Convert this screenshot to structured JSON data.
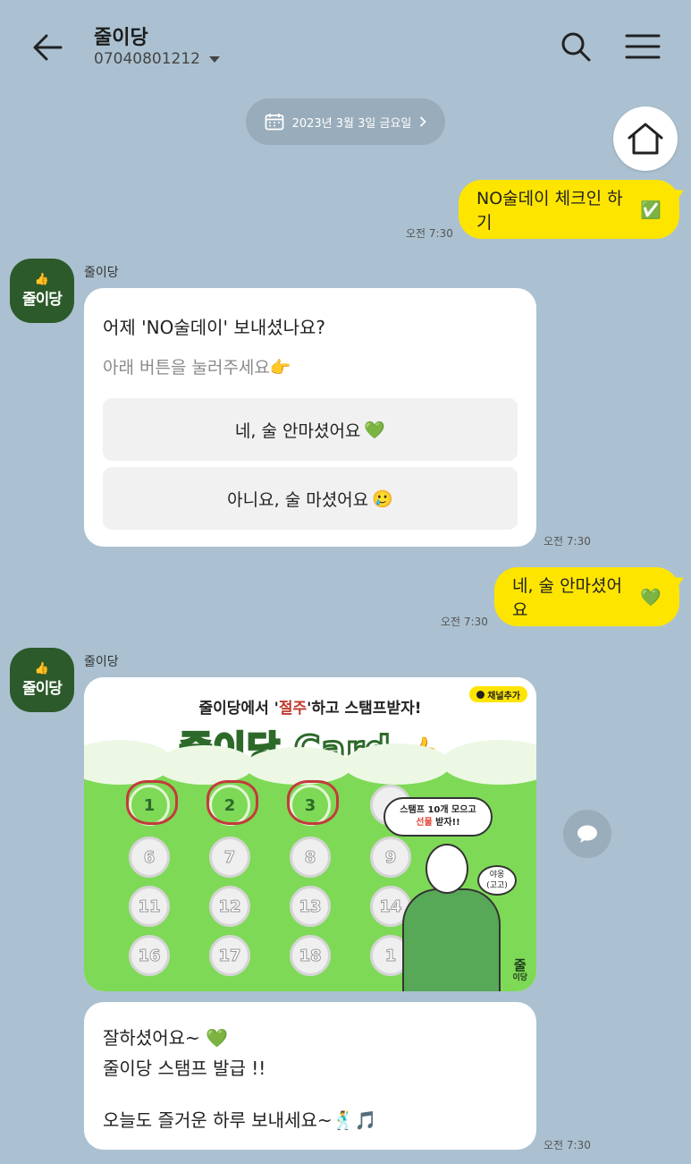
{
  "header": {
    "title": "줄이당",
    "phone": "07040801212"
  },
  "date_pill": {
    "label": "2023년 3월 3일 금요일"
  },
  "messages": {
    "checkin": {
      "text": "NO술데이 체크인 하기",
      "emoji": "✅",
      "time": "오전 7:30"
    },
    "question": {
      "sender": "줄이당",
      "line1": "어제 'NO술데이' 보내셨나요?",
      "line2": "아래 버튼을 눌러주세요",
      "line2_emoji": "👉",
      "option_yes": "네, 술 안마셨어요",
      "option_yes_emoji": "💚",
      "option_no": "아니요, 술 마셨어요",
      "option_no_emoji": "🥲",
      "time": "오전 7:30"
    },
    "answer": {
      "text": "네, 술 안마셨어요",
      "emoji": "💚",
      "time": "오전 7:30"
    },
    "stamp": {
      "sender": "줄이당",
      "slogan_prefix": "줄이당에서 '",
      "slogan_highlight": "절주",
      "slogan_suffix": "'하고 스탬프받자!",
      "brand": "줄이당 Card",
      "add_channel": "채널추가",
      "speech_line1": "스탬프 10개 모으고",
      "speech_highlight": "선물",
      "speech_line2": "받자!!",
      "speech2_line1": "야옹",
      "speech2_line2": "(고고)",
      "logo_line1": "줄",
      "logo_line2": "이당",
      "stamps": [
        {
          "n": "1"
        },
        {
          "n": "2"
        },
        {
          "n": "3"
        },
        {
          "n": ""
        },
        {
          "n": "6"
        },
        {
          "n": "7"
        },
        {
          "n": "8"
        },
        {
          "n": "9"
        },
        {
          "n": "11"
        },
        {
          "n": "12"
        },
        {
          "n": "13"
        },
        {
          "n": "14"
        },
        {
          "n": "16"
        },
        {
          "n": "17"
        },
        {
          "n": "18"
        },
        {
          "n": "1"
        }
      ]
    },
    "final": {
      "line1": "잘하셨어요~",
      "line1_emoji": "💚",
      "line2": "줄이당 스탬프 발급 !!",
      "line3": "오늘도 즐거운 하루 보내세요~",
      "line3_emoji": "🕺🎵",
      "time": "오전 7:30"
    }
  },
  "colors": {
    "my_bubble": "#fee500",
    "background": "#abc1d1",
    "brand_green": "#2c5a2a"
  }
}
